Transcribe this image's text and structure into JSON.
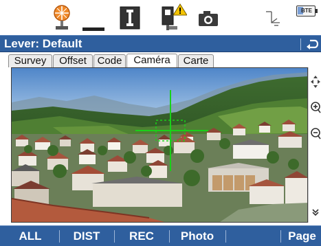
{
  "title_bar": {
    "title": "Lever: Default",
    "back_icon": "back-arrow-icon"
  },
  "tabs": [
    {
      "label": "Survey",
      "active": false
    },
    {
      "label": "Offset",
      "active": false
    },
    {
      "label": "Code",
      "active": false
    },
    {
      "label": "Caméra",
      "active": true
    },
    {
      "label": "Carte",
      "active": false
    }
  ],
  "status_bar": {
    "icons": [
      "prism-target-icon",
      "reflectorless-measure-icon",
      "instrument-icon",
      "camera-instrument-warning-icon",
      "camera-icon",
      "coordinate-axes-icon",
      "battery-icon"
    ],
    "battery_label": "BTE"
  },
  "side_tools": [
    "pan-arrows-icon",
    "zoom-in-icon",
    "zoom-out-icon",
    "scroll-down-icon"
  ],
  "softkeys": [
    {
      "label": "ALL"
    },
    {
      "label": "DIST"
    },
    {
      "label": "REC"
    },
    {
      "label": "Photo"
    },
    {
      "label": ""
    },
    {
      "label": "Page"
    }
  ],
  "colors": {
    "bar_blue": "#2f5f9e",
    "crosshair": "#19d119",
    "prism_orange": "#f08a2a",
    "warning": "#f5c400"
  }
}
